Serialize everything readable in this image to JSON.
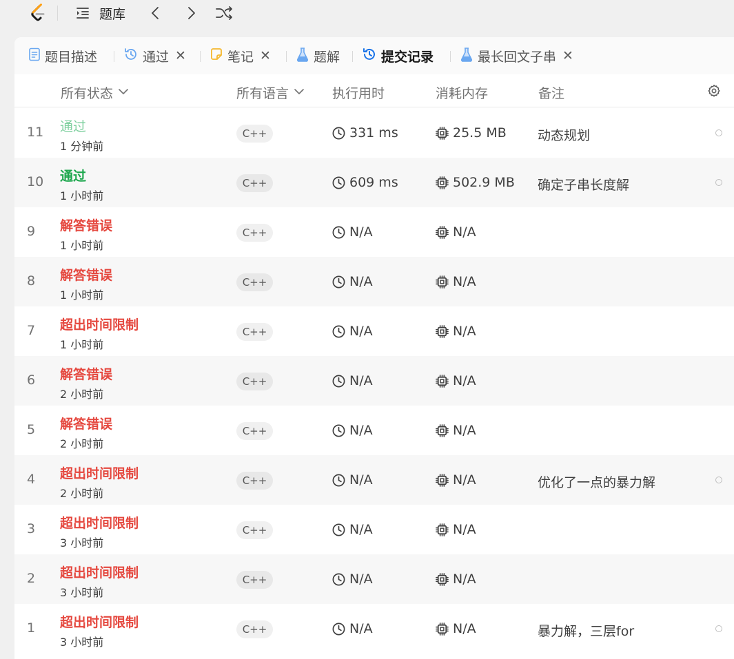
{
  "topbar": {
    "problems_label": "题库"
  },
  "tabs": [
    {
      "label": "题目描述",
      "icon": "document-icon",
      "closable": false,
      "active": false
    },
    {
      "label": "通过",
      "icon": "history-icon",
      "closable": true,
      "active": false
    },
    {
      "label": "笔记",
      "icon": "note-icon",
      "closable": true,
      "active": false
    },
    {
      "label": "题解",
      "icon": "flask-icon",
      "closable": false,
      "active": false
    },
    {
      "label": "提交记录",
      "icon": "history-icon",
      "closable": false,
      "active": true
    },
    {
      "label": "最长回文子串",
      "icon": "flask-icon",
      "closable": true,
      "active": false
    }
  ],
  "close_glyph": "✕",
  "table": {
    "headers": {
      "status": "所有状态",
      "language": "所有语言",
      "runtime": "执行用时",
      "memory": "消耗内存",
      "notes": "备注"
    },
    "rows": [
      {
        "index": "11",
        "status": "通过",
        "status_kind": "ac-light",
        "time": "1 分钟前",
        "language": "C++",
        "runtime": "331 ms",
        "memory": "25.5 MB",
        "note": "动态规划",
        "has_dot": true
      },
      {
        "index": "10",
        "status": "通过",
        "status_kind": "ac",
        "time": "1 小时前",
        "language": "C++",
        "runtime": "609 ms",
        "memory": "502.9 MB",
        "note": "确定子串长度解",
        "has_dot": true
      },
      {
        "index": "9",
        "status": "解答错误",
        "status_kind": "err",
        "time": "1 小时前",
        "language": "C++",
        "runtime": "N/A",
        "memory": "N/A",
        "note": "",
        "has_dot": false
      },
      {
        "index": "8",
        "status": "解答错误",
        "status_kind": "err",
        "time": "1 小时前",
        "language": "C++",
        "runtime": "N/A",
        "memory": "N/A",
        "note": "",
        "has_dot": false
      },
      {
        "index": "7",
        "status": "超出时间限制",
        "status_kind": "err",
        "time": "1 小时前",
        "language": "C++",
        "runtime": "N/A",
        "memory": "N/A",
        "note": "",
        "has_dot": false
      },
      {
        "index": "6",
        "status": "解答错误",
        "status_kind": "err",
        "time": "2 小时前",
        "language": "C++",
        "runtime": "N/A",
        "memory": "N/A",
        "note": "",
        "has_dot": false
      },
      {
        "index": "5",
        "status": "解答错误",
        "status_kind": "err",
        "time": "2 小时前",
        "language": "C++",
        "runtime": "N/A",
        "memory": "N/A",
        "note": "",
        "has_dot": false
      },
      {
        "index": "4",
        "status": "超出时间限制",
        "status_kind": "err",
        "time": "2 小时前",
        "language": "C++",
        "runtime": "N/A",
        "memory": "N/A",
        "note": "优化了一点的暴力解",
        "has_dot": true
      },
      {
        "index": "3",
        "status": "超出时间限制",
        "status_kind": "err",
        "time": "3 小时前",
        "language": "C++",
        "runtime": "N/A",
        "memory": "N/A",
        "note": "",
        "has_dot": false
      },
      {
        "index": "2",
        "status": "超出时间限制",
        "status_kind": "err",
        "time": "3 小时前",
        "language": "C++",
        "runtime": "N/A",
        "memory": "N/A",
        "note": "",
        "has_dot": false
      },
      {
        "index": "1",
        "status": "超出时间限制",
        "status_kind": "err",
        "time": "3 小时前",
        "language": "C++",
        "runtime": "N/A",
        "memory": "N/A",
        "note": "暴力解，三层for",
        "has_dot": true
      }
    ]
  },
  "colors": {
    "accepted": "#1fa84f",
    "accepted_light": "#7ccf9d",
    "error": "#e5483f",
    "active_tab_icon": "#1a73e8",
    "tab_icon_blue": "#6aa7f0",
    "note_icon_yellow": "#f5b82e"
  }
}
